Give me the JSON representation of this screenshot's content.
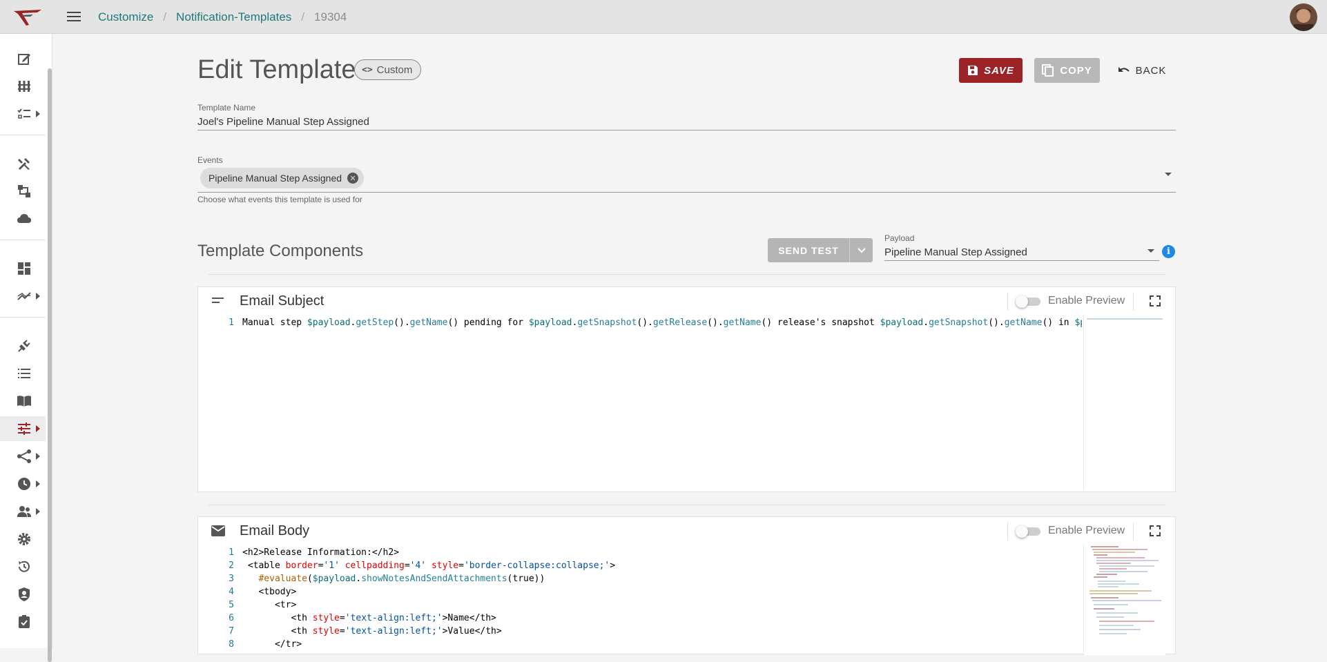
{
  "breadcrumb": {
    "items": [
      "Customize",
      "Notification-Templates"
    ],
    "current": "19304"
  },
  "page": {
    "title": "Edit Template",
    "badge": "Custom",
    "badge_icon": "code-icon"
  },
  "actions": {
    "save": "SAVE",
    "copy": "COPY",
    "back": "BACK"
  },
  "template_name": {
    "label": "Template Name",
    "value": "Joel's Pipeline Manual Step Assigned"
  },
  "events": {
    "label": "Events",
    "chips": [
      "Pipeline Manual Step Assigned"
    ],
    "helper": "Choose what events this template is used for"
  },
  "components": {
    "title": "Template Components",
    "send_test": "SEND TEST",
    "payload_label": "Payload",
    "payload_value": "Pipeline Manual Step Assigned"
  },
  "email_subject": {
    "title": "Email Subject",
    "preview_label": "Enable Preview",
    "line_numbers": [
      "1"
    ]
  },
  "email_body": {
    "title": "Email Body",
    "preview_label": "Enable Preview",
    "line_numbers": [
      "1",
      "2",
      "3",
      "4",
      "5",
      "6",
      "7",
      "8"
    ]
  },
  "sidebar": {
    "icons": [
      "edit-icon",
      "bar-chart-icon",
      "checklist-icon",
      "tools-icon",
      "pipeline-icon",
      "cloud-icon",
      "dashboard-icon",
      "trending-icon",
      "plugin-icon",
      "list-icon",
      "book-icon",
      "tune-icon",
      "workflow-icon",
      "clock-icon",
      "users-icon",
      "settings-icon",
      "history-icon",
      "security-icon",
      "approval-icon"
    ]
  },
  "colors": {
    "brand": "#9b2226",
    "link": "#1e7a78",
    "info": "#1e88e5"
  }
}
